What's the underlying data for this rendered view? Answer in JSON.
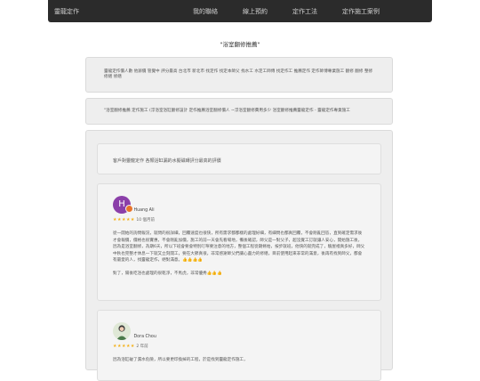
{
  "navbar": {
    "brand": "靈龍定作",
    "links": [
      "我的聯絡",
      "線上預約",
      "定作工法",
      "定作施工案例"
    ]
  },
  "page": {
    "title": "\"浴室翻修推薦\""
  },
  "tags_box": {
    "text": "靈龍定作價人數 他辦價 管覺中 評分最高 台北市 新北市 找定作 找定本師父 找水工 水定工師傅 找定作工 推薦定作 定作師傅專業施工 翻修 翻修 整修 修繕 修繕"
  },
  "search_box": {
    "text": "\"浴室翻修推薦 定作施工 (浮浴室浴缸翻修設計 定作推薦浴室翻修價人 ~浮浴室翻修費用多少 浴室翻修推薦靈龍定作 - 靈龍定作專業施工"
  },
  "reviews": {
    "header": "客戶對靈龍定作 各類浴缸漏的水擬磁磚評分最高的評價",
    "items": [
      {
        "avatar_letter": "H",
        "author": "Huang Ali",
        "stars": "★★★★★",
        "time": "10 個月前",
        "body": "從一開始的詢問報況，就問的很詳細，回覆速度也很快，所有需求都都樣的處理好細，有細問也都真回覆，不會剛亂回答，直到確定需求後才會報價，價格也很實惠，不會剛亂加價，施工的前一天會先看場地，備後確認，師父是一對父子，超沒覺工訂就讓人安心，開始施工後，因為是浴室翻修，為期6天，所以下班會要會特別叮嚀要注意的地方，整個工程從期條始，按步就班，他快的就完成了，驗屋裡真多好，師父中秋也完整才休息一下就又立刻開工，要在大節真很，非常感謝師父們讓心盡力的修繕，目前使用起來非常的滿意，後再有找到師父，都會有最愛的人，找靈龍定作，絕對滿意。👍👍👍👍",
        "reply": "對了，陽後吃浴也處理的很乾淨，不馬虎，非常優秀👍👍👍"
      },
      {
        "author": "Dora Chou",
        "stars": "★★★★★",
        "time": "2 年前",
        "body": "因為浴缸破了漏水危險，所以要更印換掉的工程，於是找到靈龍定作施工，"
      }
    ]
  },
  "colors": {
    "navbar_bg": "#2b2b2b",
    "star": "#f3b21c",
    "avatar1": "#8b3fa9"
  },
  "icons": {
    "avatar2": "woman-portrait-icon"
  }
}
